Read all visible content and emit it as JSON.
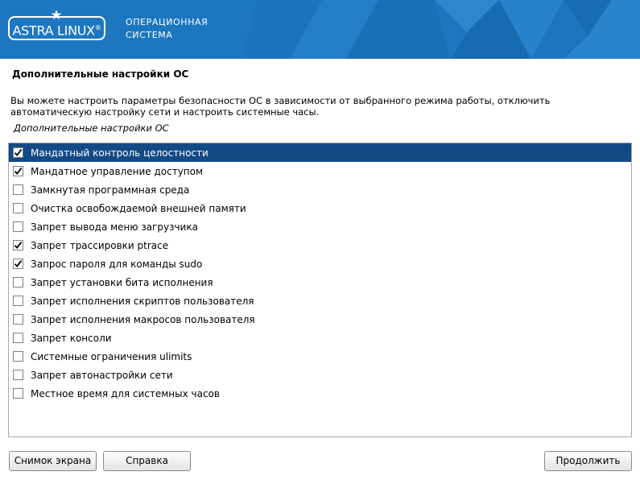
{
  "banner": {
    "logo_text": "ASTRA LINUX",
    "logo_mark": "®",
    "subtitle_line1": "ОПЕРАЦИОННАЯ",
    "subtitle_line2": "СИСТЕМА",
    "bg_color": "#1d77c0"
  },
  "page": {
    "title": "Дополнительные настройки ОС",
    "description": "Вы можете настроить параметры безопасности ОС в зависимости от выбранного режима работы, отключить автоматическую настройку сети и настроить системные часы.",
    "list_label": "Дополнительные настройки ОС"
  },
  "options": [
    {
      "label": "Мандатный контроль целостности",
      "checked": true,
      "selected": true
    },
    {
      "label": "Мандатное управление доступом",
      "checked": true,
      "selected": false
    },
    {
      "label": "Замкнутая программная среда",
      "checked": false,
      "selected": false
    },
    {
      "label": "Очистка освобождаемой внешней памяти",
      "checked": false,
      "selected": false
    },
    {
      "label": "Запрет вывода меню загрузчика",
      "checked": false,
      "selected": false
    },
    {
      "label": "Запрет трассировки ptrace",
      "checked": true,
      "selected": false
    },
    {
      "label": "Запрос пароля для команды sudo",
      "checked": true,
      "selected": false
    },
    {
      "label": "Запрет установки бита исполнения",
      "checked": false,
      "selected": false
    },
    {
      "label": "Запрет исполнения скриптов пользователя",
      "checked": false,
      "selected": false
    },
    {
      "label": "Запрет исполнения макросов пользователя",
      "checked": false,
      "selected": false
    },
    {
      "label": "Запрет консоли",
      "checked": false,
      "selected": false
    },
    {
      "label": "Системные ограничения ulimits",
      "checked": false,
      "selected": false
    },
    {
      "label": "Запрет автонастройки сети",
      "checked": false,
      "selected": false
    },
    {
      "label": "Местное время для системных часов",
      "checked": false,
      "selected": false
    }
  ],
  "buttons": {
    "screenshot": "Снимок экрана",
    "help": "Справка",
    "continue": "Продолжить"
  },
  "colors": {
    "selection": "#134a86",
    "accent": "#1d77c0"
  },
  "icons": {
    "checkbox_checked": "checkmark-icon",
    "logo_star": "star-icon"
  }
}
